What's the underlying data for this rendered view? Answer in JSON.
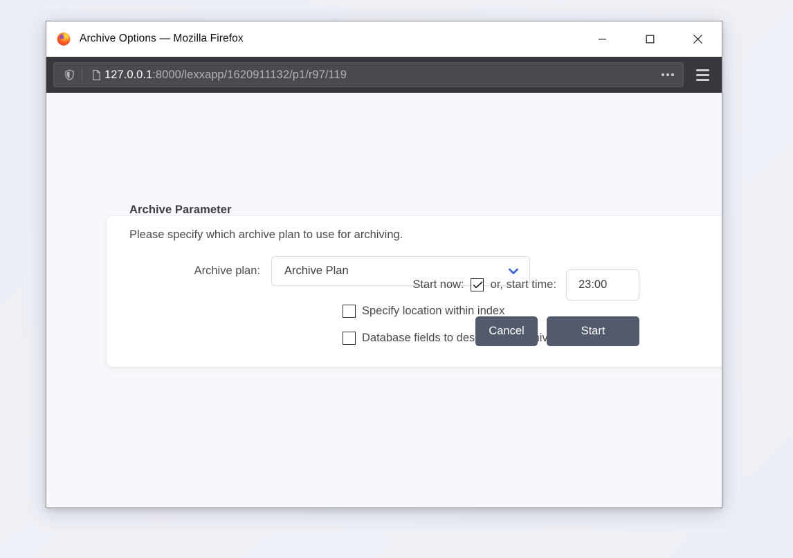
{
  "window": {
    "title": "Archive Options — Mozilla Firefox",
    "logo_icon": "firefox-logo",
    "controls": {
      "minimize": "minimize-icon",
      "maximize": "maximize-icon",
      "close": "close-icon"
    }
  },
  "navbar": {
    "shield_icon": "shield-icon",
    "page_icon": "page-document-icon",
    "url_host": "127.0.0.1",
    "url_path": ":8000/lexxapp/1620911132/p1/r97/119",
    "url_full": "127.0.0.1:8000/lexxapp/1620911132/p1/r97/119",
    "more_icon": "ellipsis-icon",
    "menu_icon": "hamburger-menu-icon"
  },
  "page": {
    "section_title": "Archive Parameter",
    "description": "Please specify which archive plan to use for archiving.",
    "archive_plan": {
      "label": "Archive plan:",
      "value": "Archive Plan",
      "options": [
        "Archive Plan"
      ],
      "chevron_icon": "chevron-down-icon",
      "chevron_color": "#3d63d8"
    },
    "checkboxes": [
      {
        "label": "Specify location within index",
        "checked": false
      },
      {
        "label": "Database fields to describe all archived files",
        "checked": false
      }
    ],
    "schedule": {
      "start_now_label": "Start now:",
      "start_now_checked": true,
      "or_label": "or, start time:",
      "start_time_value": "23:00"
    },
    "buttons": {
      "cancel": "Cancel",
      "start": "Start"
    }
  },
  "colors": {
    "button_bg": "#525a6b",
    "navbar_bg": "#37373c",
    "page_bg": "#f7f8fb",
    "card_bg": "#ffffff",
    "accent": "#3d63d8"
  }
}
